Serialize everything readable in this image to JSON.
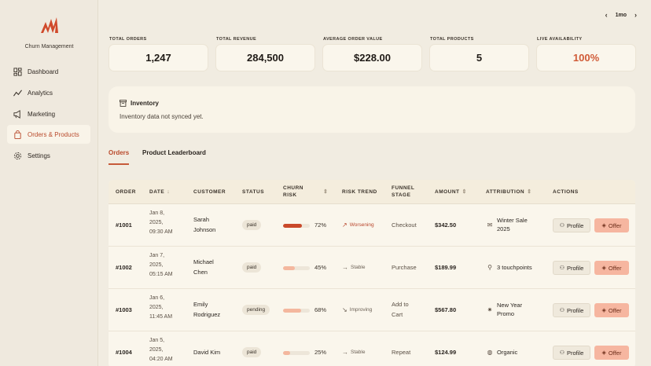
{
  "brand": {
    "name": "Churn Management"
  },
  "nav": [
    {
      "label": "Dashboard",
      "icon": "dashboard-icon",
      "active": false
    },
    {
      "label": "Analytics",
      "icon": "analytics-icon",
      "active": false
    },
    {
      "label": "Marketing",
      "icon": "megaphone-icon",
      "active": false
    },
    {
      "label": "Orders & Products",
      "icon": "shopping-bag-icon",
      "active": true
    },
    {
      "label": "Settings",
      "icon": "gear-icon",
      "active": false
    }
  ],
  "range": {
    "label": "1mo",
    "prev": "‹",
    "next": "›"
  },
  "stats": [
    {
      "label": "TOTAL ORDERS",
      "value": "1,247"
    },
    {
      "label": "TOTAL REVENUE",
      "value": "284,500"
    },
    {
      "label": "AVERAGE ORDER VALUE",
      "value": "$228.00"
    },
    {
      "label": "TOTAL PRODUCTS",
      "value": "5"
    },
    {
      "label": "LIVE AVAILABILITY",
      "value": "100%"
    }
  ],
  "inventory": {
    "title": "Inventory",
    "message": "Inventory data not synced yet."
  },
  "tabs": [
    {
      "label": "Orders",
      "active": true
    },
    {
      "label": "Product Leaderboard",
      "active": false
    }
  ],
  "table": {
    "headers": {
      "order": "ORDER",
      "date": "DATE",
      "customer": "CUSTOMER",
      "status": "STATUS",
      "churn_1": "CHURN",
      "churn_2": "RISK",
      "trend": "RISK TREND",
      "funnel_1": "FUNNEL",
      "funnel_2": "STAGE",
      "amount": "AMOUNT",
      "attribution": "ATTRIBUTION",
      "actions": "ACTIONS"
    },
    "sort_desc": "↓",
    "sort_both": "⇕",
    "action_profile": "Profile",
    "action_offer": "Offer",
    "rows": [
      {
        "order": "#1001",
        "date": [
          "Jan 8,",
          "2025,",
          "09:30 AM"
        ],
        "customer": [
          "Sarah",
          "Johnson"
        ],
        "status": "paid",
        "churn_pct": "72%",
        "churn_value": 0.72,
        "bar_color": "#c9492a",
        "trend": "Worsening",
        "trend_icon": "↗",
        "trend_color": "#b8442a",
        "funnel": [
          "Checkout"
        ],
        "amount": "$342.50",
        "attribution": [
          "Winter Sale",
          "2025"
        ],
        "attr_icon": "✉"
      },
      {
        "order": "#1002",
        "date": [
          "Jan 7,",
          "2025,",
          "05:15 AM"
        ],
        "customer": [
          "Michael",
          "Chen"
        ],
        "status": "paid",
        "churn_pct": "45%",
        "churn_value": 0.45,
        "bar_color": "#f4b79e",
        "trend": "Stable",
        "trend_icon": "→",
        "trend_color": "#6b6055",
        "funnel": [
          "Purchase"
        ],
        "amount": "$189.99",
        "attribution": [
          "3 touchpoints"
        ],
        "attr_icon": "⚲"
      },
      {
        "order": "#1003",
        "date": [
          "Jan 6,",
          "2025,",
          "11:45 AM"
        ],
        "customer": [
          "Emily",
          "Rodriguez"
        ],
        "status": "pending",
        "churn_pct": "68%",
        "churn_value": 0.68,
        "bar_color": "#f4b79e",
        "trend": "Improving",
        "trend_icon": "↘",
        "trend_color": "#6b6055",
        "funnel": [
          "Add to",
          "Cart"
        ],
        "amount": "$567.80",
        "attribution": [
          "New Year",
          "Promo"
        ],
        "attr_icon": "✷"
      },
      {
        "order": "#1004",
        "date": [
          "Jan 5,",
          "2025,",
          "04:20 AM"
        ],
        "customer": [
          "David Kim"
        ],
        "status": "paid",
        "churn_pct": "25%",
        "churn_value": 0.25,
        "bar_color": "#f4b79e",
        "trend": "Stable",
        "trend_icon": "→",
        "trend_color": "#6b6055",
        "funnel": [
          "Repeat"
        ],
        "amount": "$124.99",
        "attribution": [
          "Organic"
        ],
        "attr_icon": "◍"
      }
    ]
  },
  "colors": {
    "accent": "#c65a3a",
    "offer_bg": "#f6b6a0",
    "background": "#f1ece1"
  }
}
